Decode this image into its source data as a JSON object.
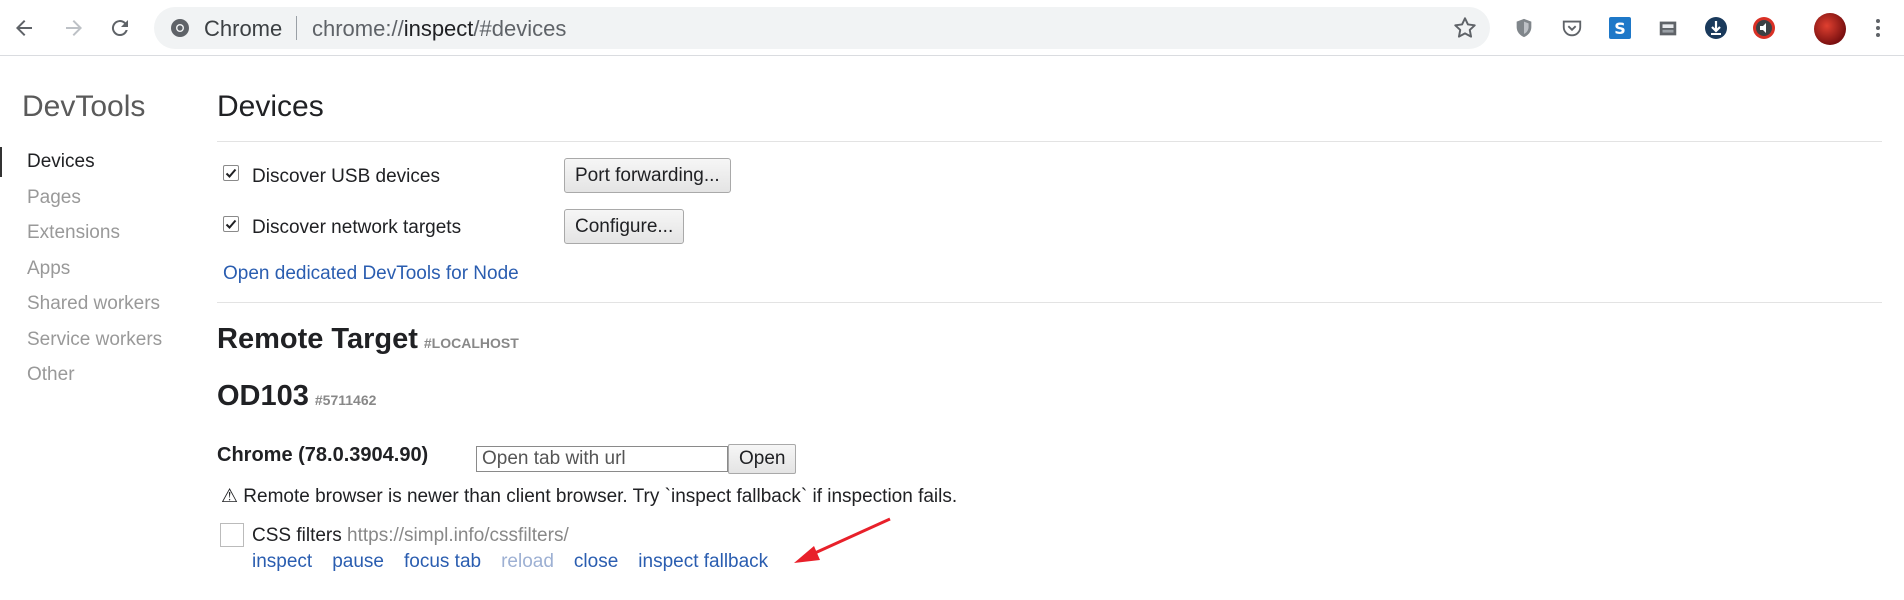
{
  "browser": {
    "omnibox": {
      "chip": "Chrome",
      "url_scheme": "chrome://",
      "url_host": "inspect",
      "url_rest": "/#devices"
    },
    "extensions": [
      "shield-extension-icon",
      "pocket-extension-icon",
      "s-extension-icon",
      "save-extension-icon",
      "download-extension-icon",
      "audio-extension-icon"
    ]
  },
  "sidebar": {
    "title": "DevTools",
    "items": [
      {
        "label": "Devices",
        "active": true
      },
      {
        "label": "Pages",
        "active": false
      },
      {
        "label": "Extensions",
        "active": false
      },
      {
        "label": "Apps",
        "active": false
      },
      {
        "label": "Shared workers",
        "active": false
      },
      {
        "label": "Service workers",
        "active": false
      },
      {
        "label": "Other",
        "active": false
      }
    ]
  },
  "main": {
    "heading": "Devices",
    "discover_usb": {
      "label": "Discover USB devices",
      "checked": true
    },
    "discover_network": {
      "label": "Discover network targets",
      "checked": true
    },
    "port_forwarding_label": "Port forwarding...",
    "configure_label": "Configure...",
    "node_link": "Open dedicated DevTools for Node",
    "remote_target": {
      "title": "Remote Target",
      "tag": "#LOCALHOST"
    },
    "device": {
      "name": "OD103",
      "serial": "#5711462"
    },
    "browser_name": "Chrome (78.0.3904.90)",
    "open_tab": {
      "placeholder": "Open tab with url",
      "button": "Open"
    },
    "warning": "⚠ Remote browser is newer than client browser. Try `inspect fallback` if inspection fails.",
    "page": {
      "name": "CSS filters",
      "url": "https://simpl.info/cssfilters/",
      "actions": {
        "inspect": "inspect",
        "pause": "pause",
        "focus_tab": "focus tab",
        "reload": "reload",
        "close": "close",
        "inspect_fallback": "inspect fallback"
      }
    }
  },
  "colors": {
    "link": "#2a5db0",
    "annotation_arrow": "#e8202a"
  }
}
